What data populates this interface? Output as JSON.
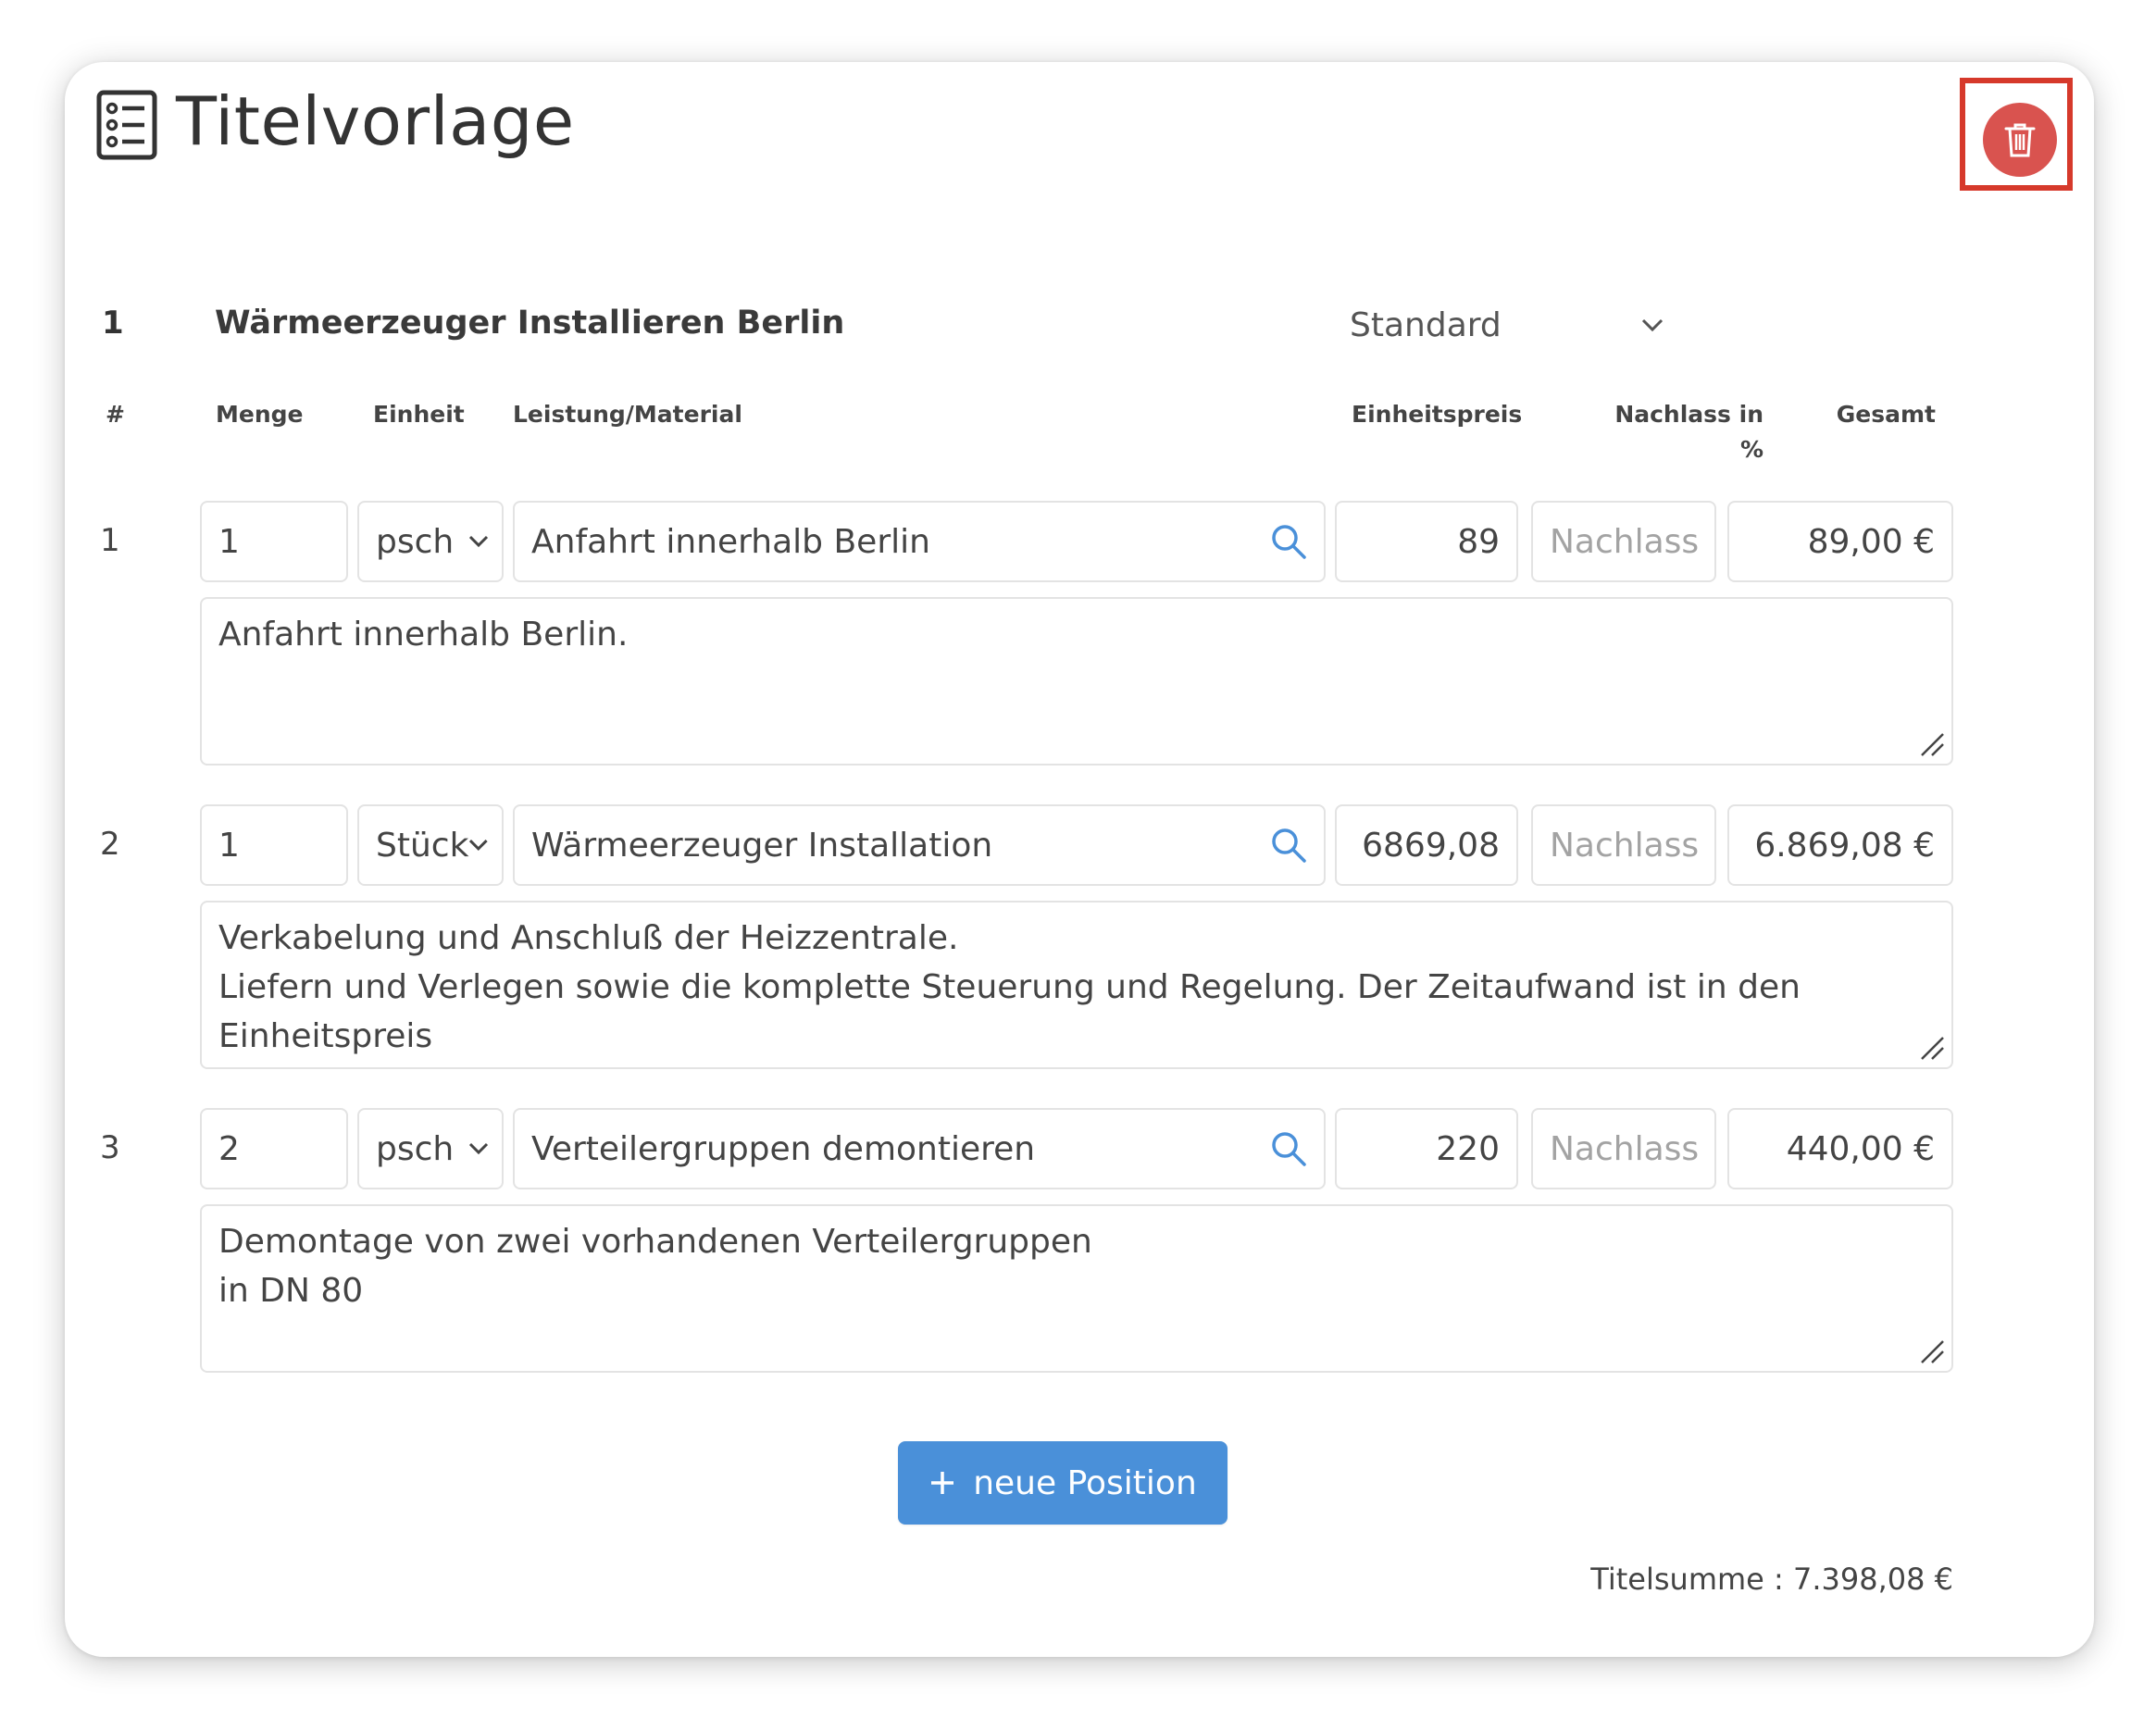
{
  "header": {
    "title": "Titelvorlage",
    "title_icon": "list-icon",
    "delete_icon": "trash-icon",
    "delete_color": "#d9534f"
  },
  "section": {
    "number": "1",
    "title": "Wärmeerzeuger Installieren Berlin",
    "price_mode": "Standard"
  },
  "columns": {
    "num": "#",
    "menge": "Menge",
    "einheit": "Einheit",
    "leistung": "Leistung/Material",
    "einheitspreis": "Einheitspreis",
    "nachlass_line1": "Nachlass in",
    "nachlass_line2": "%",
    "gesamt": "Gesamt"
  },
  "rows": [
    {
      "num": "1",
      "menge": "1",
      "einheit": "psch",
      "leistung": "Anfahrt innerhalb Berlin",
      "einheitspreis": "89",
      "nachlass_placeholder": "Nachlass",
      "gesamt": "89,00 €",
      "description": [
        "Anfahrt innerhalb Berlin."
      ]
    },
    {
      "num": "2",
      "menge": "1",
      "einheit": "Stück",
      "leistung": "Wärmeerzeuger Installation",
      "einheitspreis": "6869,08",
      "nachlass_placeholder": "Nachlass",
      "gesamt": "6.869,08 €",
      "description": [
        "Verkabelung und Anschluß der Heizzentrale.",
        "Liefern und Verlegen sowie die komplette Steuerung und Regelung. Der Zeitaufwand ist in den",
        "Einheitspreis"
      ]
    },
    {
      "num": "3",
      "menge": "2",
      "einheit": "psch",
      "leistung": "Verteilergruppen demontieren",
      "einheitspreis": "220",
      "nachlass_placeholder": "Nachlass",
      "gesamt": "440,00 €",
      "description": [
        "Demontage von zwei vorhandenen Verteilergruppen",
        "in DN 80"
      ]
    }
  ],
  "add_button": {
    "label": "neue Position",
    "color": "#4a90d9"
  },
  "total": "Titelsumme : 7.398,08 €"
}
